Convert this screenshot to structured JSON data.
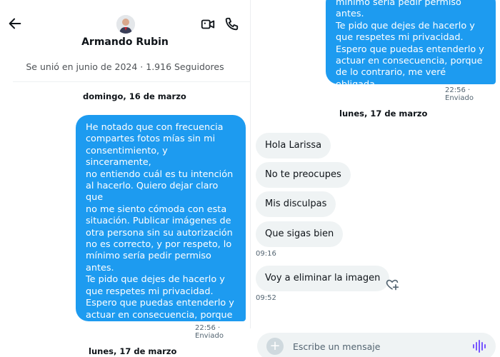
{
  "conversation": {
    "contact_name": "Armando Rubin",
    "profile_summary": "Se unió en junio de 2024 · 1.916 Seguidores"
  },
  "icons": {
    "back": "arrow-left-icon",
    "video": "video-camera-icon",
    "phone": "phone-icon",
    "react": "heart-plus-icon",
    "add": "plus-icon",
    "voice": "voice-wave-icon"
  },
  "colors": {
    "sent_bubble": "#1d9bf0",
    "received_bubble": "#eff3f4",
    "voice_accent": "#7856ff"
  },
  "left_view": {
    "date_1": "domingo, 16 de marzo",
    "sent_message": "He notado que con frecuencia\ncompartes fotos mías sin mi\nconsentimiento, y sinceramente,\nno entiendo cuál es tu intención\nal hacerlo. Quiero dejar claro que\nno me siento cómoda con esta\nsituación. Publicar imágenes de\notra persona sin su autorización\nno es correcto, y por respeto, lo\nmínimo sería pedir permiso antes.\nTe pido que dejes de hacerlo y\nque respetes mi privacidad.\nEspero que puedas entenderlo y\nactuar en consecuencia, porque\nde lo contrario, me veré obligada\na tomar otras medidas!",
    "sent_meta": "22:56 · Enviado",
    "date_2": "lunes, 17 de marzo"
  },
  "right_view": {
    "sent_message_tail": "mínimo sería pedir permiso antes.\nTe pido que dejes de hacerlo y\nque respetes mi privacidad.\nEspero que puedas entenderlo y\nactuar en consecuencia, porque\nde lo contrario, me veré obligada\na tomar otras medidas!",
    "sent_meta": "22:56 · Enviado",
    "date": "lunes, 17 de marzo",
    "received": [
      "Hola Larissa",
      "No te preocupes",
      "Mis disculpas",
      "Que sigas bien",
      "Voy a eliminar la imagen"
    ],
    "time_1": "09:16",
    "time_2": "09:52",
    "composer_placeholder": "Escribe un mensaje"
  }
}
